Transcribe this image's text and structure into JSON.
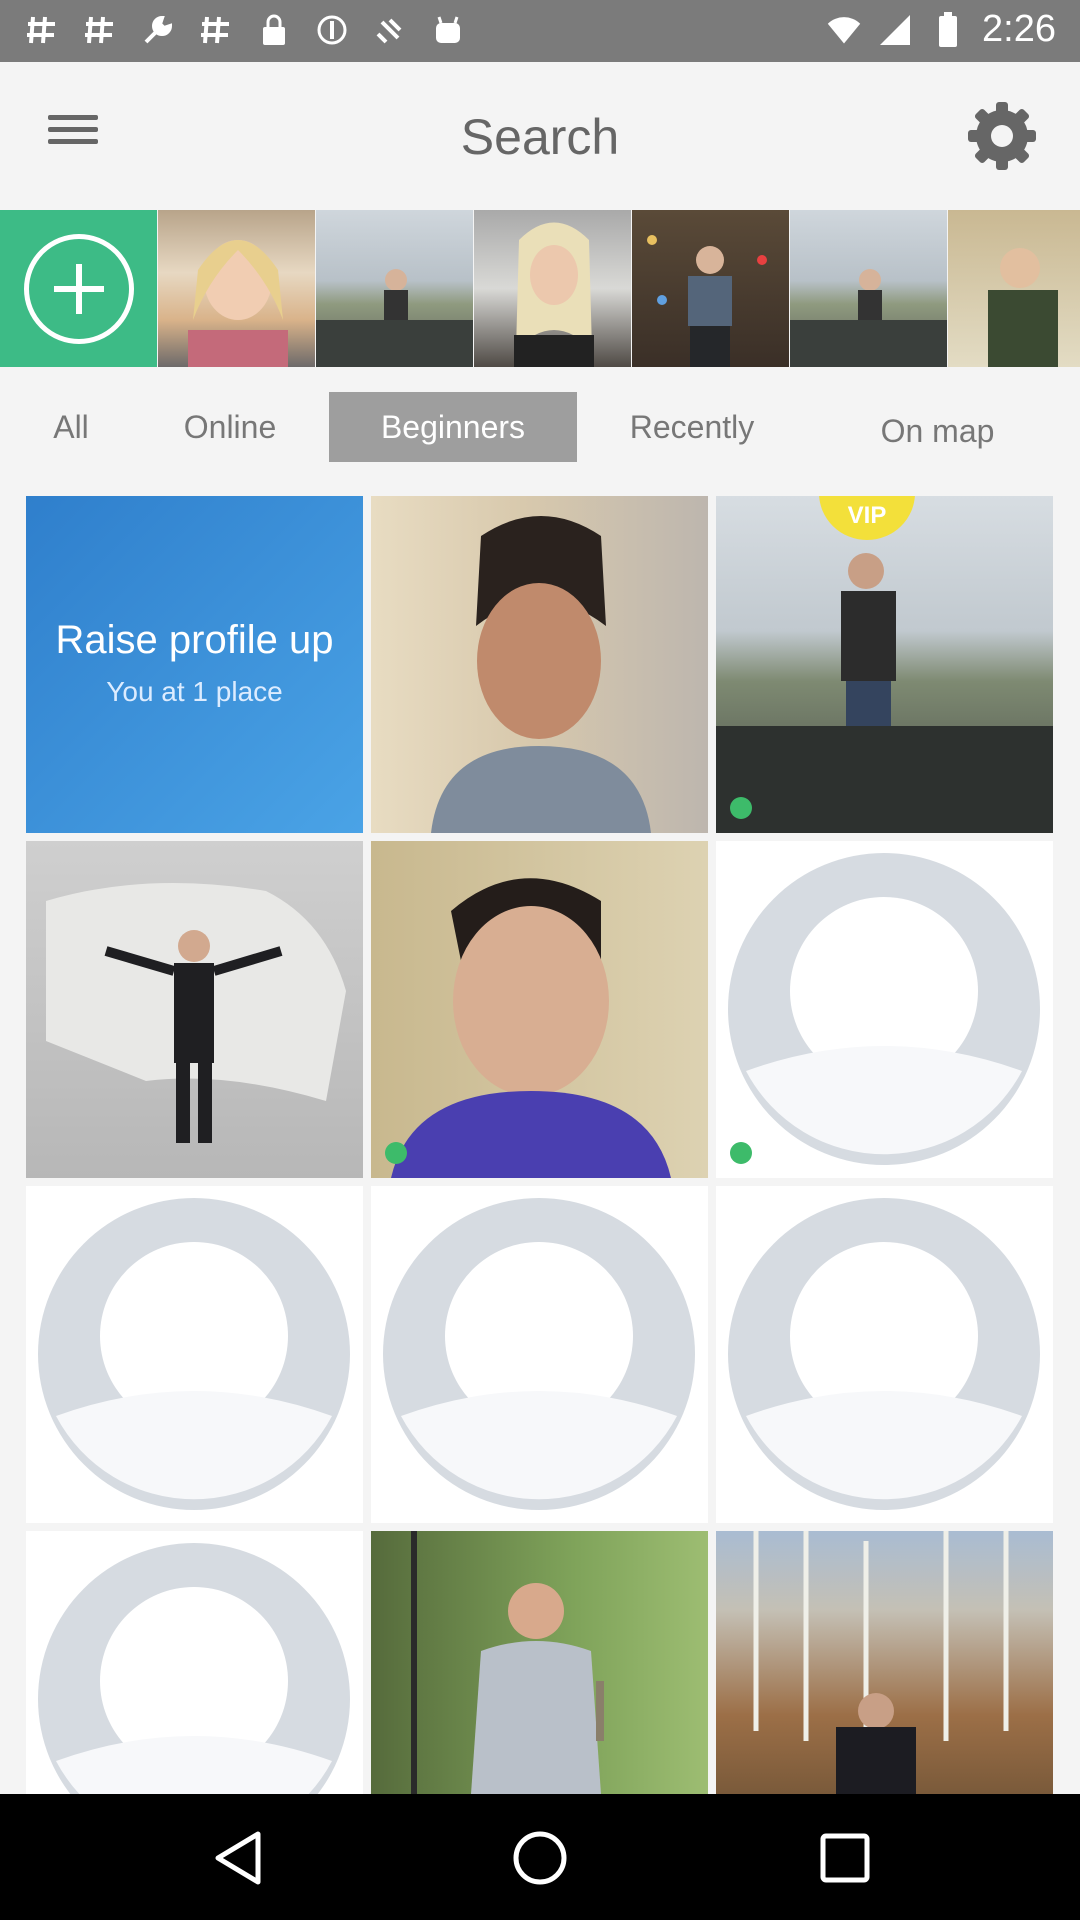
{
  "status_bar": {
    "time": "2:26",
    "left_icons": [
      "hashtag-icon",
      "hashtag-icon",
      "wrench-icon",
      "hashtag-icon",
      "lock-icon",
      "blocked-icon",
      "satellite-icon",
      "android-icon"
    ],
    "right_icons": [
      "wifi-icon",
      "signal-icon",
      "battery-icon"
    ]
  },
  "app_bar": {
    "title": "Search",
    "menu_icon": "hamburger-menu-icon",
    "settings_icon": "gear-icon"
  },
  "stories": {
    "add_icon": "plus-circle-icon",
    "items": [
      {
        "photo": "woman-blonde-car"
      },
      {
        "photo": "man-by-river"
      },
      {
        "photo": "woman-blonde-room"
      },
      {
        "photo": "man-christmas-tree"
      },
      {
        "photo": "man-by-river"
      },
      {
        "photo": "man-green-shirt"
      }
    ]
  },
  "tabs": [
    {
      "label": "All",
      "active": false
    },
    {
      "label": "Online",
      "active": false
    },
    {
      "label": "Beginners",
      "active": true
    },
    {
      "label": "Recently",
      "active": false
    },
    {
      "label": "On map",
      "active": false
    }
  ],
  "promo": {
    "title": "Raise profile up",
    "subtitle": "You at 1 place"
  },
  "grid": [
    {
      "type": "promo"
    },
    {
      "type": "photo",
      "photo": "man-selfie-grey-shirt",
      "online": false,
      "vip": false
    },
    {
      "type": "photo",
      "photo": "man-sitting-by-river",
      "online": true,
      "vip": true,
      "vip_label": "VIP"
    },
    {
      "type": "photo",
      "photo": "man-suit-map",
      "online": false,
      "vip": false
    },
    {
      "type": "photo",
      "photo": "man-blue-sweater",
      "online": true,
      "vip": false
    },
    {
      "type": "placeholder",
      "online": true
    },
    {
      "type": "placeholder",
      "online": false
    },
    {
      "type": "placeholder",
      "online": false
    },
    {
      "type": "placeholder",
      "online": false
    },
    {
      "type": "placeholder",
      "online": false
    },
    {
      "type": "photo",
      "photo": "man-fishing",
      "online": false,
      "vip": false
    },
    {
      "type": "photo",
      "photo": "man-birch-forest",
      "online": false,
      "vip": false
    }
  ],
  "nav_bar": {
    "back_icon": "back-triangle-icon",
    "home_icon": "home-circle-icon",
    "recents_icon": "recents-square-icon"
  },
  "colors": {
    "accent_green": "#3dbb86",
    "promo_blue": "#3a8fd6",
    "vip_yellow": "#f3e03a",
    "online_green": "#3dbb6a",
    "tab_active": "#9e9e9e"
  }
}
